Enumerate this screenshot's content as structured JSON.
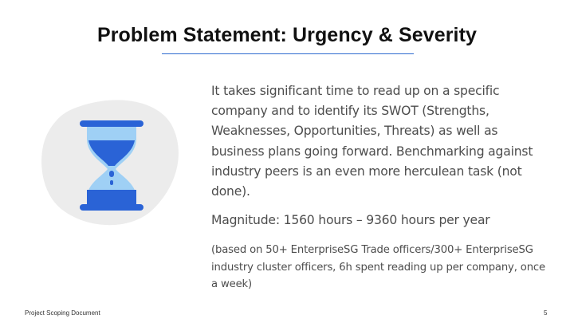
{
  "slide": {
    "title": "Problem Statement: Urgency & Severity",
    "body": {
      "paragraph": "It takes significant time to read up on a specific company and to identify its SWOT (Strengths, Weaknesses, Opportunities, Threats) as well as business plans going forward. Benchmarking against industry peers is an even more herculean task (not done).",
      "magnitude": "Magnitude: 1560 hours – 9360 hours per year",
      "note": "(based on 50+ EnterpriseSG Trade officers/300+ EnterpriseSG industry cluster officers, 6h spent reading up per company, once a week)"
    },
    "illustration_icon": "hourglass-icon",
    "footer": {
      "label": "Project Scoping Document",
      "page_number": "5"
    }
  },
  "colors": {
    "accent": "#2e6bd0",
    "hourglass_dark": "#2a63d6",
    "hourglass_light": "#9fd0f5",
    "blob": "#ececec",
    "text": "#4d4d4d",
    "title": "#111111"
  }
}
